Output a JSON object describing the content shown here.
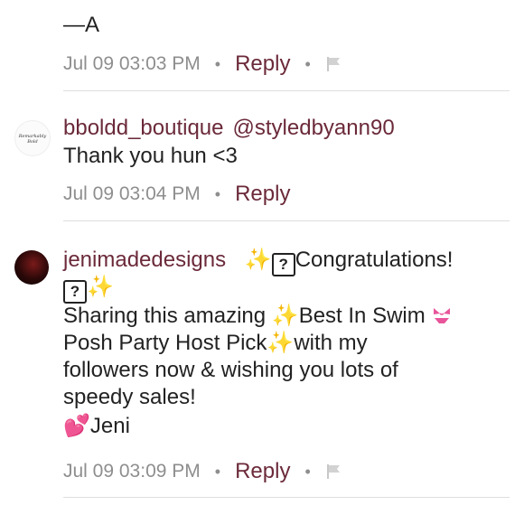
{
  "comment1": {
    "tail_text": "—A",
    "timestamp": "Jul 09 03:03 PM",
    "reply_label": "Reply"
  },
  "comment2": {
    "username": "bboldd_boutique",
    "mention": "@styledbyann90",
    "text": "Thank you hun <3",
    "timestamp": "Jul 09 03:04 PM",
    "reply_label": "Reply",
    "avatar_text": "Remarkably Bold"
  },
  "comment3": {
    "username": "jenimadedesigns",
    "line1_after": "Congratulations!",
    "line2_text": "Sharing this amazing ",
    "line2_b": "Best In Swim ",
    "line3_a": "Posh Party Host Pick",
    "line3_b": "with my",
    "line4": "followers now & wishing you lots of",
    "line5": "speedy sales!",
    "signoff": "Jeni",
    "timestamp": "Jul 09 03:09 PM",
    "reply_label": "Reply"
  },
  "icons": {
    "flag": "flag-icon",
    "sparkles": "sparkles-icon",
    "question": "question-box-icon",
    "bikini": "bikini-icon",
    "hearts": "two-hearts-icon"
  },
  "colors": {
    "accent": "#6b2a3a",
    "muted": "#8e8e8e",
    "divider": "#dedede"
  }
}
